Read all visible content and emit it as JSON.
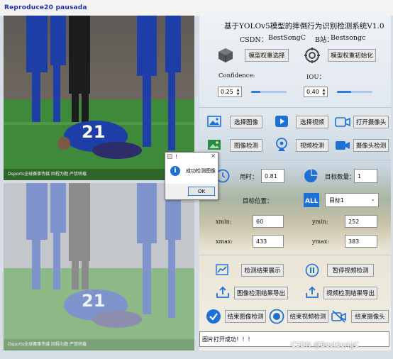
{
  "window": {
    "title_overlay": "Reproduce20 pausada"
  },
  "header": {
    "title": "基于YOLOv5模型的摔倒行为识别检测系统V1.0",
    "csdn_label": "CSDN：",
    "csdn_value": "BestSongC",
    "bilibili_label": "B站：",
    "bilibili_value": "Bestsongc"
  },
  "model": {
    "select_button": "模型权重选择",
    "init_button": "模型权重初始化"
  },
  "params": {
    "confidence_label": "Confidence:",
    "confidence_value": "0.25",
    "confidence_level": 0.25,
    "iou_label": "IOU：",
    "iou_value": "0.40",
    "iou_level": 0.4
  },
  "actions": {
    "select_image": "选择图像",
    "select_video": "选择视频",
    "open_camera": "打开摄像头",
    "image_detect": "图像检测",
    "video_detect": "视频检测",
    "camera_detect": "摄像头检测"
  },
  "results": {
    "time_label": "用时：",
    "time_value": "0.81",
    "count_label": "目标数量：",
    "count_value": "1",
    "position_label": "目标位置：",
    "target_select": "目标1",
    "xmin_label": "xmin:",
    "xmin_value": "60",
    "ymin_label": "ymin:",
    "ymin_value": "252",
    "xmax_label": "xmax:",
    "xmax_value": "433",
    "ymax_label": "ymax:",
    "ymax_value": "383"
  },
  "bottom": {
    "show_results": "检测结果展示",
    "pause_video": "暂停视频检测",
    "export_image": "图像检测结果导出",
    "export_video": "视频检测结果导出",
    "end_image": "结束图像检测",
    "end_video": "结束视频检测",
    "end_camera": "结束摄像头"
  },
  "status": {
    "message": "图片打开成功！！！"
  },
  "dialog": {
    "title": "！",
    "close": "×",
    "message": "成功检测图像",
    "ok": "OK"
  },
  "image_overlays": {
    "top_caption": "Dsports全球赛事传媒 回程为题 严禁转载",
    "bottom_caption": "Dsports全球赛事传媒 回程为题 严禁转载",
    "jersey_number": "21"
  },
  "watermark": {
    "csdn": "CSDN @BestSongC"
  },
  "colors": {
    "accent_blue": "#2e7bd6",
    "icon_blue": "#1e6fd6",
    "pitch_green": "#3f8a3a",
    "kit_blue": "#1f3fa8"
  }
}
